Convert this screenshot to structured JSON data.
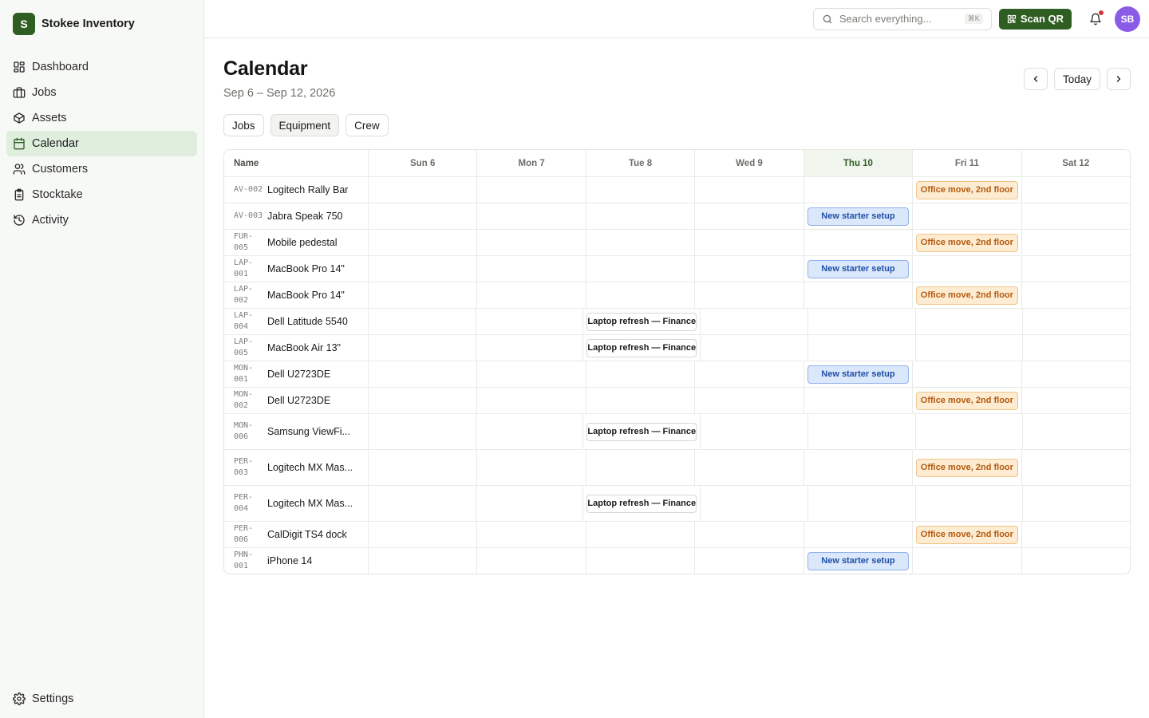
{
  "brand": {
    "logo": "S",
    "name": "Stokee Inventory"
  },
  "nav": [
    {
      "label": "Dashboard",
      "icon": "dashboard-icon"
    },
    {
      "label": "Jobs",
      "icon": "briefcase-icon"
    },
    {
      "label": "Assets",
      "icon": "box-icon"
    },
    {
      "label": "Calendar",
      "icon": "calendar-icon",
      "active": true
    },
    {
      "label": "Customers",
      "icon": "users-icon"
    },
    {
      "label": "Stocktake",
      "icon": "clipboard-icon"
    },
    {
      "label": "Activity",
      "icon": "history-icon"
    }
  ],
  "settings": {
    "label": "Settings",
    "icon": "gear-icon"
  },
  "topbar": {
    "search_placeholder": "Search everything...",
    "search_shortcut": "⌘K",
    "scan_label": "Scan QR",
    "avatar": "SB"
  },
  "page": {
    "title": "Calendar",
    "range": "Sep 6 – Sep 12, 2026",
    "today_label": "Today"
  },
  "tabs": [
    {
      "label": "Jobs"
    },
    {
      "label": "Equipment",
      "active": true
    },
    {
      "label": "Crew"
    }
  ],
  "grid": {
    "name_header": "Name",
    "days": [
      "Sun 6",
      "Mon 7",
      "Tue 8",
      "Wed 9",
      "Thu 10",
      "Fri 11",
      "Sat 12"
    ],
    "today_index": 4,
    "colors": {
      "blue": "#dbe7fb",
      "orange": "#fdecd2",
      "accent": "#2f5e22"
    },
    "rows": [
      {
        "id": "AV-002",
        "name": "Logitech Rally Bar",
        "event": {
          "day": 5,
          "label": "Office move, 2nd floor",
          "style": "orange"
        }
      },
      {
        "id": "AV-003",
        "name": "Jabra Speak 750",
        "event": {
          "day": 4,
          "label": "New starter setup",
          "style": "blue"
        }
      },
      {
        "id": "FUR-005",
        "name": "Mobile pedestal",
        "event": {
          "day": 5,
          "label": "Office move, 2nd floor",
          "style": "orange"
        }
      },
      {
        "id": "LAP-001",
        "name": "MacBook Pro 14\"",
        "event": {
          "day": 4,
          "label": "New starter setup",
          "style": "blue"
        }
      },
      {
        "id": "LAP-002",
        "name": "MacBook Pro 14\"",
        "event": {
          "day": 5,
          "label": "Office move, 2nd floor",
          "style": "orange"
        }
      },
      {
        "id": "LAP-004",
        "name": "Dell Latitude 5540",
        "event": {
          "day": 2,
          "label": "Laptop refresh — Finance",
          "style": "white"
        }
      },
      {
        "id": "LAP-005",
        "name": "MacBook Air 13\"",
        "event": {
          "day": 2,
          "label": "Laptop refresh — Finance",
          "style": "white"
        }
      },
      {
        "id": "MON-001",
        "name": "Dell U2723DE",
        "event": {
          "day": 4,
          "label": "New starter setup",
          "style": "blue"
        }
      },
      {
        "id": "MON-002",
        "name": "Dell U2723DE",
        "event": {
          "day": 5,
          "label": "Office move, 2nd floor",
          "style": "orange"
        }
      },
      {
        "id": "MON-006",
        "name": "Samsung ViewFi...",
        "tall": true,
        "event": {
          "day": 2,
          "label": "Laptop refresh — Finance",
          "style": "white"
        }
      },
      {
        "id": "PER-003",
        "name": "Logitech MX Mas...",
        "tall": true,
        "event": {
          "day": 5,
          "label": "Office move, 2nd floor",
          "style": "orange"
        }
      },
      {
        "id": "PER-004",
        "name": "Logitech MX Mas...",
        "tall": true,
        "event": {
          "day": 2,
          "label": "Laptop refresh — Finance",
          "style": "white"
        }
      },
      {
        "id": "PER-006",
        "name": "CalDigit TS4 dock",
        "event": {
          "day": 5,
          "label": "Office move, 2nd floor",
          "style": "orange"
        }
      },
      {
        "id": "PHN-001",
        "name": "iPhone 14",
        "event": {
          "day": 4,
          "label": "New starter setup",
          "style": "blue"
        }
      }
    ]
  }
}
